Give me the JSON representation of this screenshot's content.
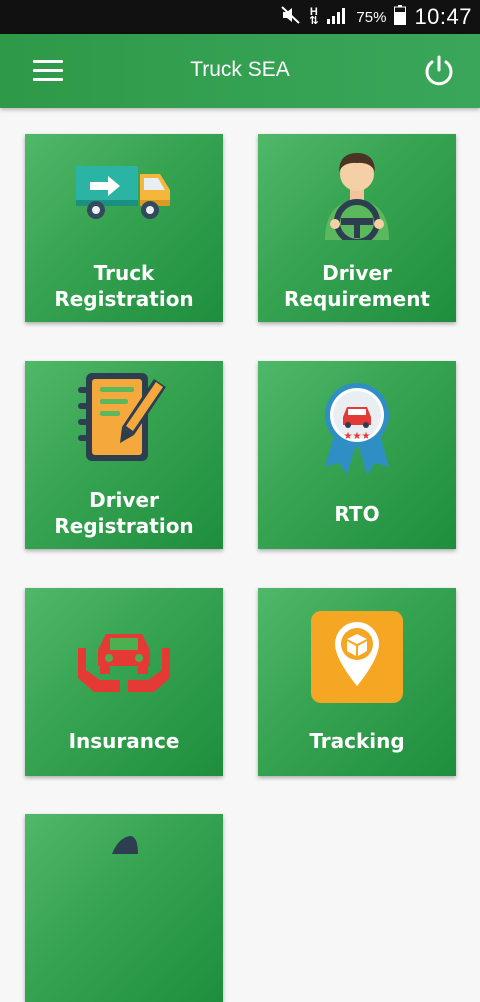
{
  "status_bar": {
    "battery": "75%",
    "time": "10:47",
    "network_letters": "H"
  },
  "app_bar": {
    "title": "Truck SEA"
  },
  "tiles": [
    {
      "line1": "Truck",
      "line2": "Registration",
      "icon": "truck-icon"
    },
    {
      "line1": "Driver",
      "line2": "Requirement",
      "icon": "driver-steering-icon"
    },
    {
      "line1": "Driver",
      "line2": "Registration",
      "icon": "notebook-pen-icon"
    },
    {
      "line1": "RTO",
      "icon": "award-badge-car-icon"
    },
    {
      "line1": "Insurance",
      "icon": "car-hands-icon"
    },
    {
      "line1": "Tracking",
      "icon": "location-box-icon"
    }
  ],
  "colors": {
    "app_bar": "#2e9a48",
    "tile_light": "#50b869",
    "tile_dark": "#1e8e3d",
    "status_bar": "#111111"
  }
}
